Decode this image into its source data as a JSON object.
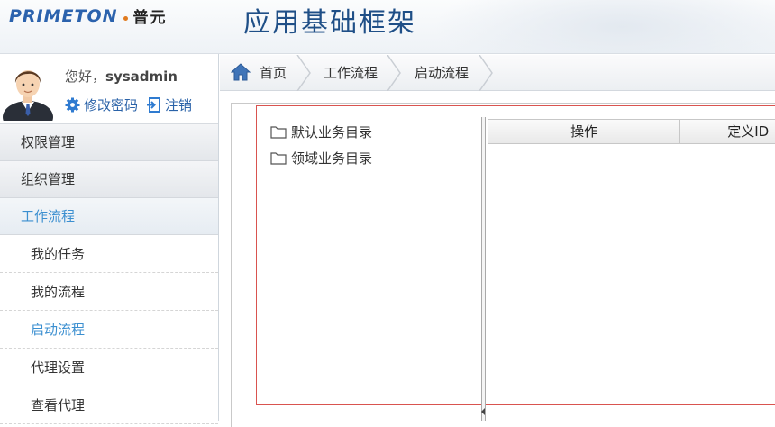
{
  "header": {
    "logo_en": "PRIMETON",
    "logo_cn": "普元",
    "app_title": "应用基础框架"
  },
  "user": {
    "greeting_prefix": "您好，",
    "username": "sysadmin",
    "change_password": "修改密码",
    "logout": "注销"
  },
  "sidebar": {
    "groups": [
      {
        "label": "权限管理"
      },
      {
        "label": "组织管理"
      },
      {
        "label": "工作流程"
      }
    ],
    "items": [
      {
        "label": "我的任务"
      },
      {
        "label": "我的流程"
      },
      {
        "label": "启动流程"
      },
      {
        "label": "代理设置"
      },
      {
        "label": "查看代理"
      }
    ]
  },
  "breadcrumb": {
    "home": "首页",
    "level1": "工作流程",
    "level2": "启动流程"
  },
  "tree": {
    "nodes": [
      {
        "label": "默认业务目录"
      },
      {
        "label": "领域业务目录"
      }
    ]
  },
  "grid": {
    "columns": [
      "操作",
      "定义ID"
    ]
  },
  "colors": {
    "brand_blue": "#2b62ad",
    "active_menu": "#3b8fd0",
    "title_blue": "#1f4f87",
    "red_frame": "#d9534f"
  }
}
